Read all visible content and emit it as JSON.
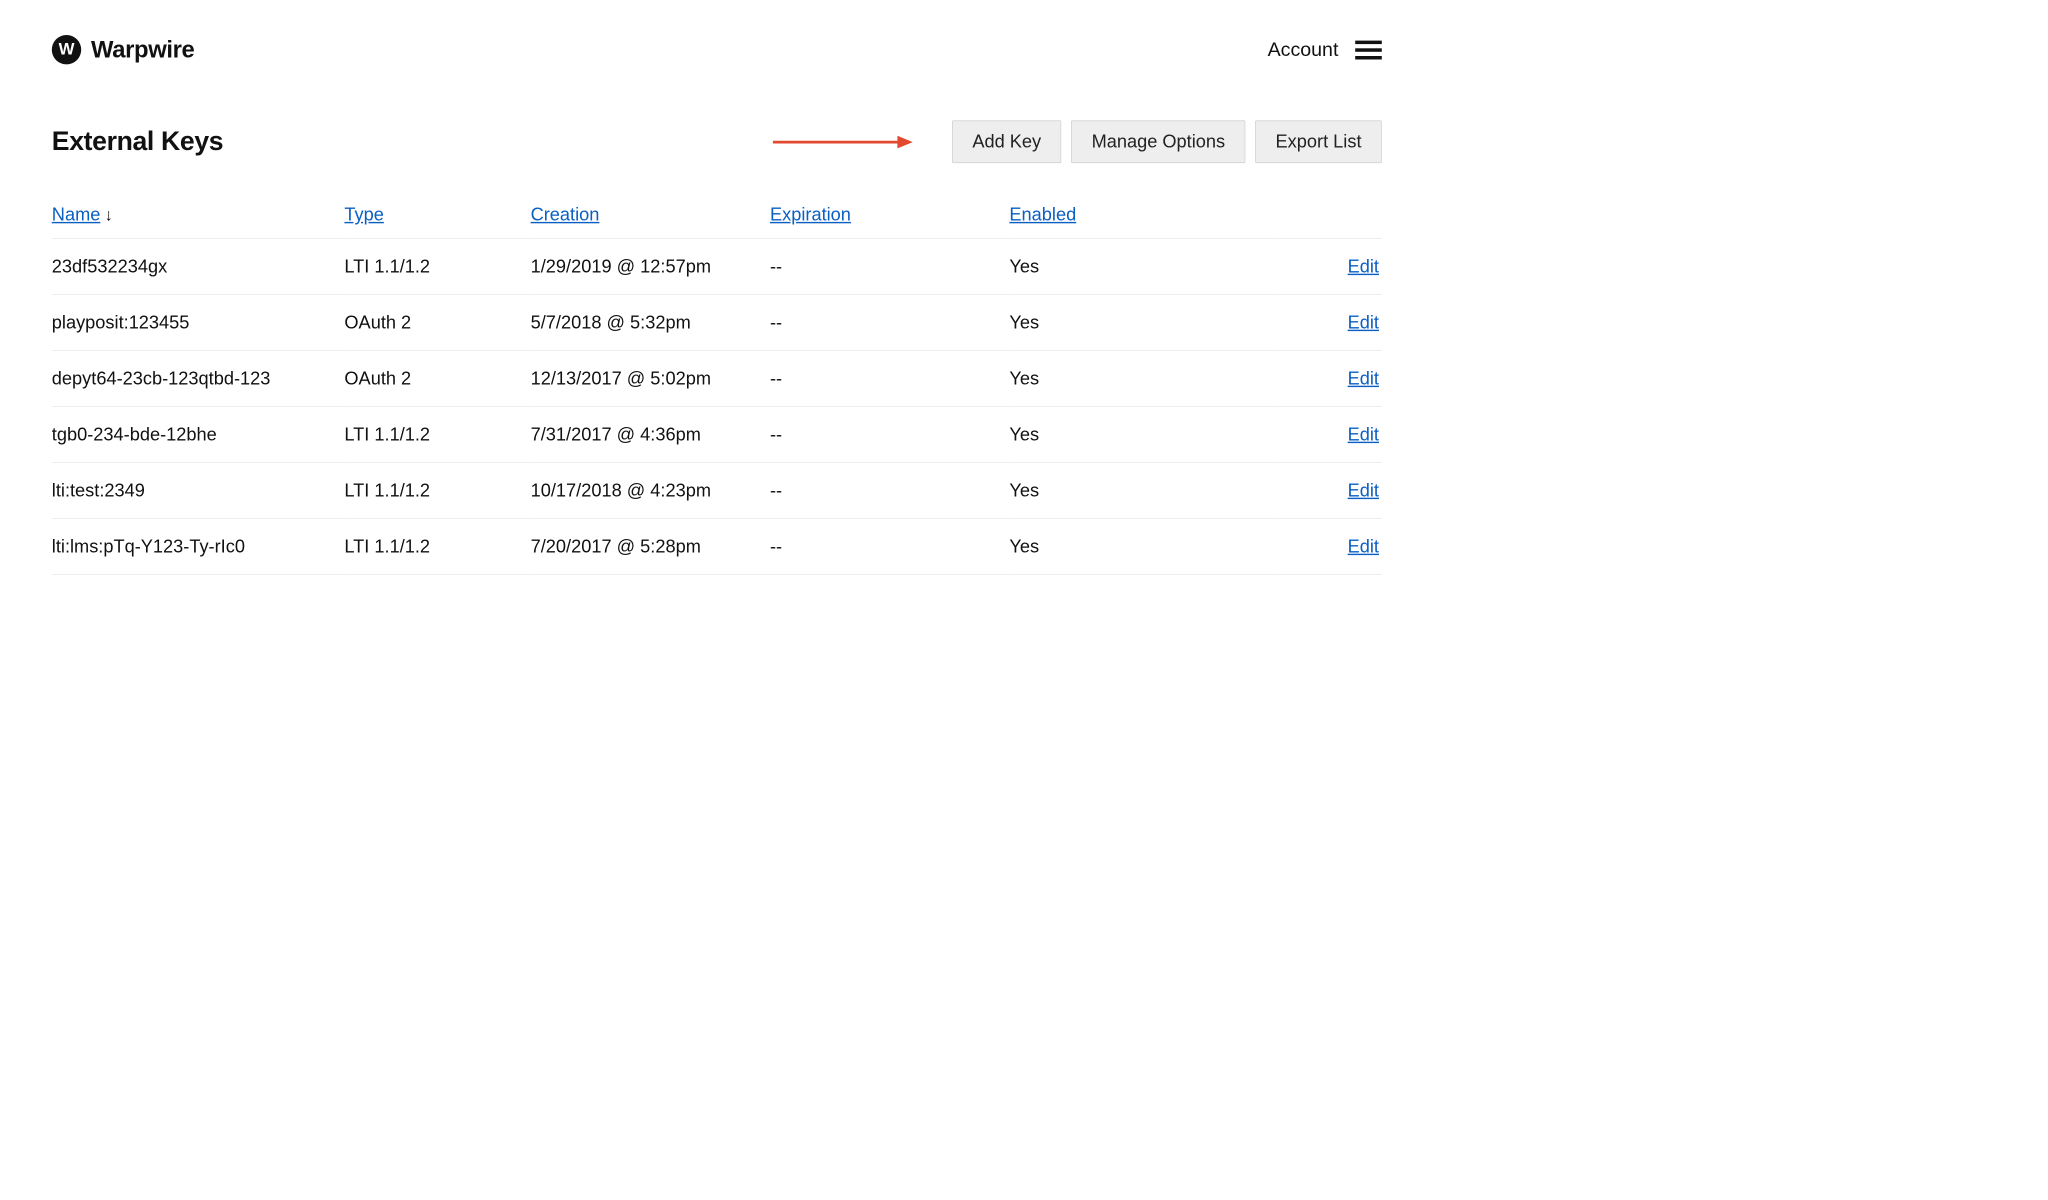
{
  "header": {
    "brand_name": "Warpwire",
    "logo_letter": "W",
    "account_label": "Account"
  },
  "page": {
    "title": "External Keys"
  },
  "actions": {
    "add_key": "Add Key",
    "manage_options": "Manage Options",
    "export_list": "Export List"
  },
  "columns": {
    "name": "Name",
    "type": "Type",
    "creation": "Creation",
    "expiration": "Expiration",
    "enabled": "Enabled",
    "sort_indicator": "↓"
  },
  "edit_label": "Edit",
  "rows": [
    {
      "name": "23df532234gx",
      "type": "LTI 1.1/1.2",
      "creation": "1/29/2019 @ 12:57pm",
      "expiration": "--",
      "enabled": "Yes"
    },
    {
      "name": "playposit:123455",
      "type": "OAuth 2",
      "creation": "5/7/2018 @ 5:32pm",
      "expiration": "--",
      "enabled": "Yes"
    },
    {
      "name": "depyt64-23cb-123qtbd-123",
      "type": "OAuth 2",
      "creation": "12/13/2017 @ 5:02pm",
      "expiration": "--",
      "enabled": "Yes"
    },
    {
      "name": "tgb0-234-bde-12bhe",
      "type": "LTI 1.1/1.2",
      "creation": "7/31/2017 @ 4:36pm",
      "expiration": "--",
      "enabled": "Yes"
    },
    {
      "name": "lti:test:2349",
      "type": "LTI 1.1/1.2",
      "creation": "10/17/2018 @ 4:23pm",
      "expiration": "--",
      "enabled": "Yes"
    },
    {
      "name": "lti:lms:pTq-Y123-Ty-rIc0",
      "type": "LTI 1.1/1.2",
      "creation": "7/20/2017 @ 5:28pm",
      "expiration": "--",
      "enabled": "Yes"
    }
  ]
}
